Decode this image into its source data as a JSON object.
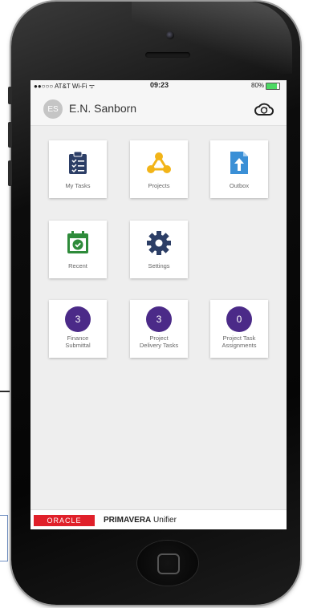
{
  "status_bar": {
    "carrier": "●●○○○ AT&T Wi-Fi ᯤ",
    "time": "09:23",
    "battery_text": "80%",
    "battery_level": 0.8
  },
  "header": {
    "avatar_initials": "ES",
    "user_name": "E.N. Sanborn",
    "sync_icon": "cloud-sync-icon"
  },
  "tiles": [
    {
      "label": "My Tasks",
      "icon": "clipboard-icon"
    },
    {
      "label": "Projects",
      "icon": "network-icon"
    },
    {
      "label": "Outbox",
      "icon": "upload-file-icon"
    },
    {
      "label": "Recent",
      "icon": "calendar-check-icon"
    },
    {
      "label": "Settings",
      "icon": "gear-icon"
    }
  ],
  "counters": [
    {
      "count": "3",
      "line1": "Finance",
      "line2": "Submittal"
    },
    {
      "count": "3",
      "line1": "Project",
      "line2": "Delivery Tasks"
    },
    {
      "count": "0",
      "line1": "Project Task",
      "line2": "Assignments"
    }
  ],
  "footer": {
    "oracle": "ORACLE",
    "brand_bold": "PRIMAVERA",
    "brand_rest": " Unifier"
  },
  "colors": {
    "accent_purple": "#4b2a88",
    "icon_navy": "#2c3e66",
    "icon_yellow": "#f2b418",
    "icon_blue": "#3a8fd6",
    "icon_green": "#2e8b3a",
    "oracle_red": "#e0202a"
  }
}
